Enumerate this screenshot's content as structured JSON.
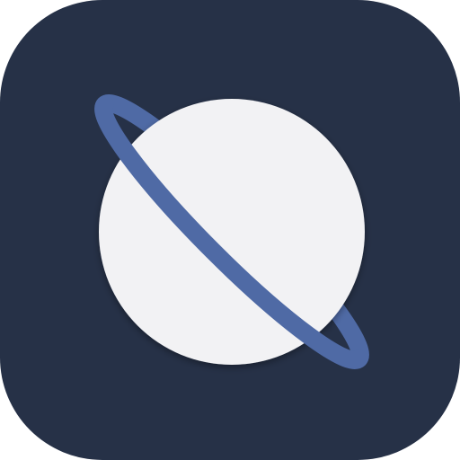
{
  "app_icon": {
    "icon": "planet-icon",
    "colors": {
      "background": "#263147",
      "planet": "#f2f2f4",
      "ring": "#4f6aa5"
    }
  }
}
